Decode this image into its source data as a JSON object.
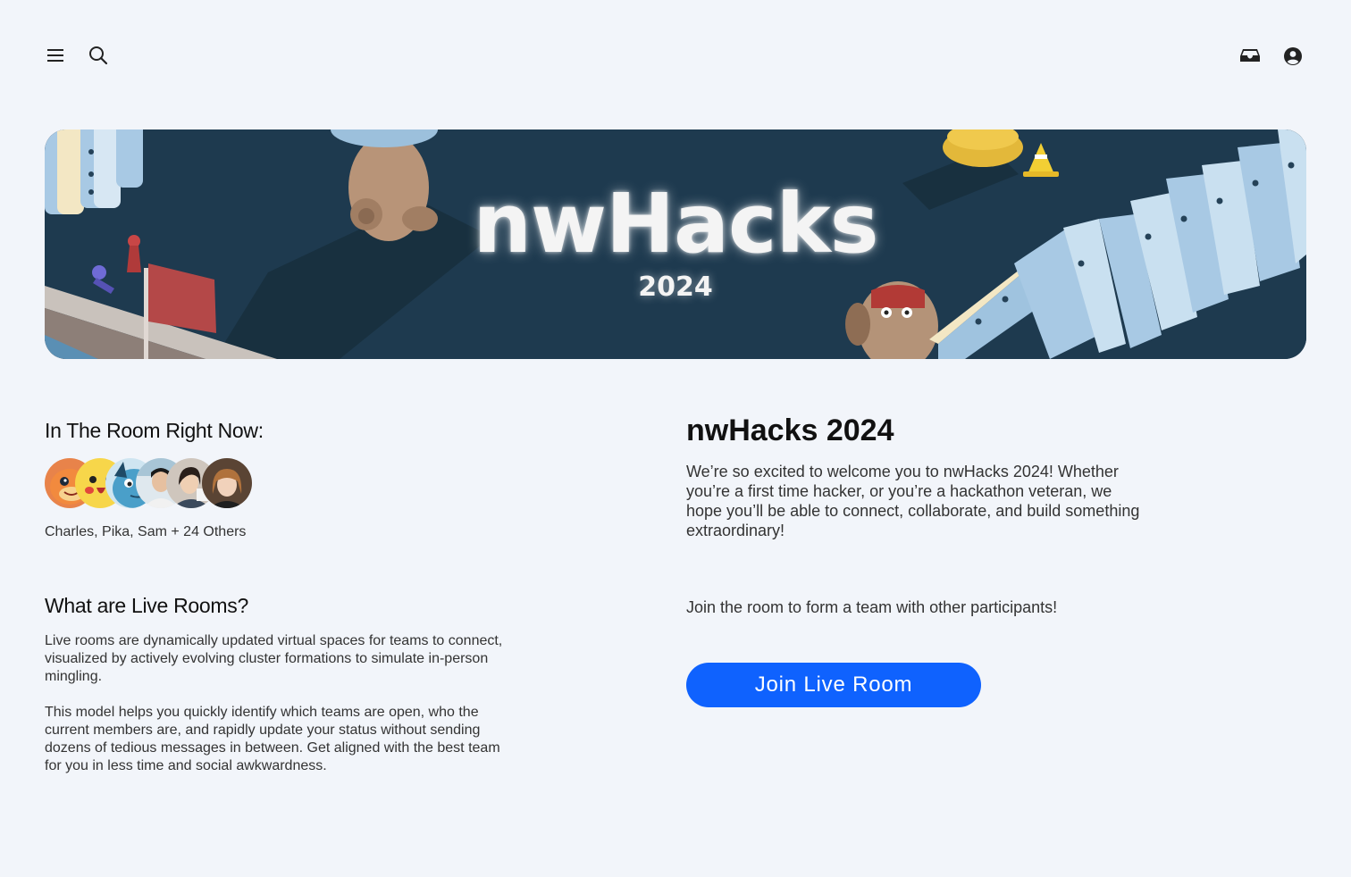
{
  "topbar": {
    "icons": {
      "menu": "hamburger-menu-icon",
      "search": "search-icon",
      "inbox": "inbox-icon",
      "account": "account-icon"
    }
  },
  "banner": {
    "title": "nwHacks",
    "year": "2024"
  },
  "room": {
    "heading": "In The Room Right Now:",
    "avatars": [
      "charmander",
      "pikachu",
      "squirtle",
      "person-1",
      "person-2",
      "person-3"
    ],
    "members_text": "Charles, Pika, Sam + 24 Others"
  },
  "live_rooms": {
    "heading": "What are Live Rooms?",
    "paragraph1": "Live rooms are dynamically updated virtual spaces for teams to connect, visualized by actively evolving cluster formations to simulate in-person mingling.",
    "paragraph2": "This model helps you quickly identify which teams are open, who the current members are, and rapidly update your status without sending dozens of tedious messages in between. Get aligned with the best team for you in less time and social awkwardness."
  },
  "event": {
    "title": "nwHacks 2024",
    "description": "We’re so excited to welcome you to nwHacks 2024! Whether you’re a first time hacker, or you’re a hackathon veteran, we hope you’ll be able to connect, collaborate, and build something extraordinary!",
    "join_hint": "Join the room to form a team with other participants!",
    "join_button_label": "Join Live Room"
  },
  "colors": {
    "background": "#f2f5fa",
    "banner_background": "#1e3a4f",
    "primary_button": "#0f62fe"
  }
}
